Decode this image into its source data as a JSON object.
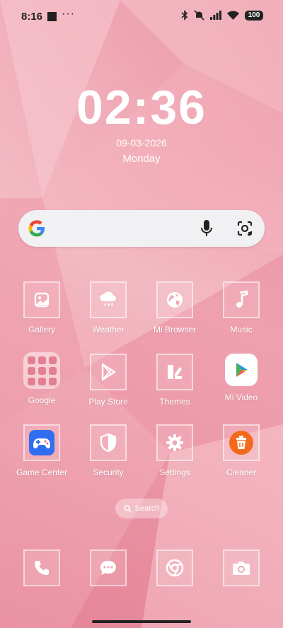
{
  "status_bar": {
    "time": "8:16",
    "more": "···",
    "battery": "100"
  },
  "clock": {
    "time": "02:36",
    "date": "09-03-2026",
    "day": "Monday"
  },
  "apps": [
    {
      "label": "Gallery",
      "icon": "gallery-icon"
    },
    {
      "label": "Weather",
      "icon": "weather-icon"
    },
    {
      "label": "Mi Browser",
      "icon": "globe-icon"
    },
    {
      "label": "Music",
      "icon": "music-note-icon"
    },
    {
      "label": "Google",
      "icon": "google-folder-icon"
    },
    {
      "label": "Play Store",
      "icon": "play-store-icon"
    },
    {
      "label": "Themes",
      "icon": "themes-icon"
    },
    {
      "label": "Mi Video",
      "icon": "mi-video-icon"
    },
    {
      "label": "Game Center",
      "icon": "gamepad-icon"
    },
    {
      "label": "Security",
      "icon": "shield-icon"
    },
    {
      "label": "Settings",
      "icon": "gear-icon"
    },
    {
      "label": "Cleaner",
      "icon": "trash-icon"
    }
  ],
  "drawer_search": {
    "label": "Search"
  },
  "dock": [
    "phone-icon",
    "messages-icon",
    "chrome-icon",
    "camera-icon"
  ],
  "colors": {
    "wallpaper": "#f0a9b5",
    "text": "#ffffff",
    "cleaner_orange": "#f36a1c",
    "game_blue": "#2f6ef0"
  }
}
